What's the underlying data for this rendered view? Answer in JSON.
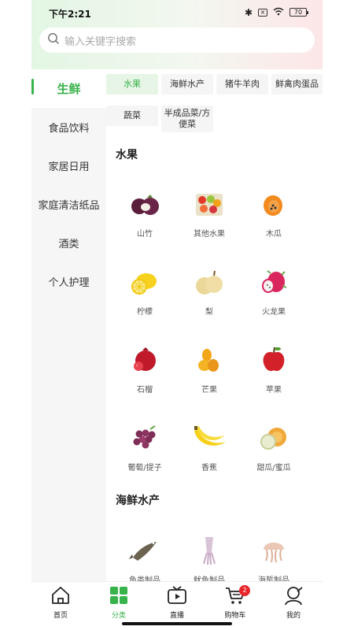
{
  "status": {
    "time": "下午2:21",
    "battery": "70"
  },
  "search": {
    "placeholder": "输入关键字搜索"
  },
  "sidebar": {
    "items": [
      {
        "label": "生鲜"
      },
      {
        "label": "食品饮料"
      },
      {
        "label": "家居日用"
      },
      {
        "label": "家庭清洁纸品"
      },
      {
        "label": "酒类"
      },
      {
        "label": "个人护理"
      }
    ]
  },
  "subtabs": [
    "水果",
    "海鲜水产",
    "猪牛羊肉",
    "鲜禽肉蛋品",
    "蔬菜",
    "半成品菜/方便菜"
  ],
  "sections": [
    {
      "title": "水果",
      "items": [
        "山竹",
        "其他水果",
        "木瓜",
        "柠檬",
        "梨",
        "火龙果",
        "石榴",
        "芒果",
        "苹果",
        "葡萄/提子",
        "香蕉",
        "甜瓜/蜜瓜"
      ]
    },
    {
      "title": "海鲜水产",
      "items": [
        "鱼类制品",
        "鱿鱼制品",
        "海蜇制品"
      ]
    }
  ],
  "tabbar": {
    "items": [
      {
        "label": "首页",
        "icon": "home-icon"
      },
      {
        "label": "分类",
        "icon": "category-icon"
      },
      {
        "label": "直播",
        "icon": "live-icon"
      },
      {
        "label": "购物车",
        "icon": "cart-icon",
        "badge": "2"
      },
      {
        "label": "我的",
        "icon": "profile-icon"
      }
    ]
  },
  "colors": {
    "accent": "#38b24a",
    "badge": "#e8262a"
  }
}
